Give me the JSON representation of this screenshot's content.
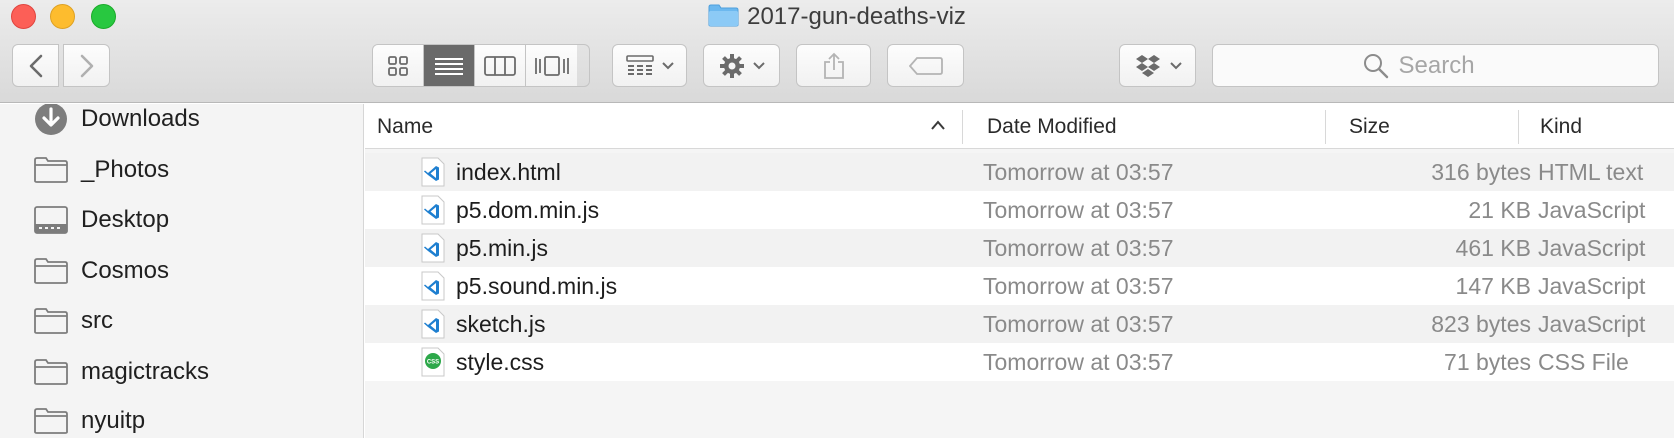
{
  "window": {
    "title": "2017-gun-deaths-viz"
  },
  "toolbar": {
    "back_icon": "chevron-left-icon",
    "forward_icon": "chevron-right-icon",
    "view_modes": [
      "icon-view",
      "list-view",
      "column-view",
      "cover-flow-view"
    ],
    "active_view": "list-view",
    "search_placeholder": "Search"
  },
  "sidebar": {
    "items": [
      {
        "label": "Downloads",
        "icon": "downloads-icon"
      },
      {
        "label": "_Photos",
        "icon": "folder-icon"
      },
      {
        "label": "Desktop",
        "icon": "desktop-folder-icon"
      },
      {
        "label": "Cosmos",
        "icon": "folder-icon"
      },
      {
        "label": "src",
        "icon": "folder-icon"
      },
      {
        "label": "magictracks",
        "icon": "folder-icon"
      },
      {
        "label": "nyuitp",
        "icon": "folder-icon"
      }
    ]
  },
  "columns": {
    "name": "Name",
    "date": "Date Modified",
    "size": "Size",
    "kind": "Kind"
  },
  "files": [
    {
      "name": "index.html",
      "date": "Tomorrow at 03:57",
      "size": "316 bytes",
      "kind": "HTML text",
      "icon": "vscode-file-icon"
    },
    {
      "name": "p5.dom.min.js",
      "date": "Tomorrow at 03:57",
      "size": "21 KB",
      "kind": "JavaScript",
      "icon": "vscode-file-icon"
    },
    {
      "name": "p5.min.js",
      "date": "Tomorrow at 03:57",
      "size": "461 KB",
      "kind": "JavaScript",
      "icon": "vscode-file-icon"
    },
    {
      "name": "p5.sound.min.js",
      "date": "Tomorrow at 03:57",
      "size": "147 KB",
      "kind": "JavaScript",
      "icon": "vscode-file-icon"
    },
    {
      "name": "sketch.js",
      "date": "Tomorrow at 03:57",
      "size": "823 bytes",
      "kind": "JavaScript",
      "icon": "vscode-file-icon"
    },
    {
      "name": "style.css",
      "date": "Tomorrow at 03:57",
      "size": "71 bytes",
      "kind": "CSS File",
      "icon": "css-file-icon"
    }
  ],
  "colors": {
    "vscode_blue": "#1e7fd0",
    "css_green": "#2da84a",
    "close": "#fc5f57",
    "minimize": "#fdbc2e",
    "zoom": "#28c840"
  }
}
